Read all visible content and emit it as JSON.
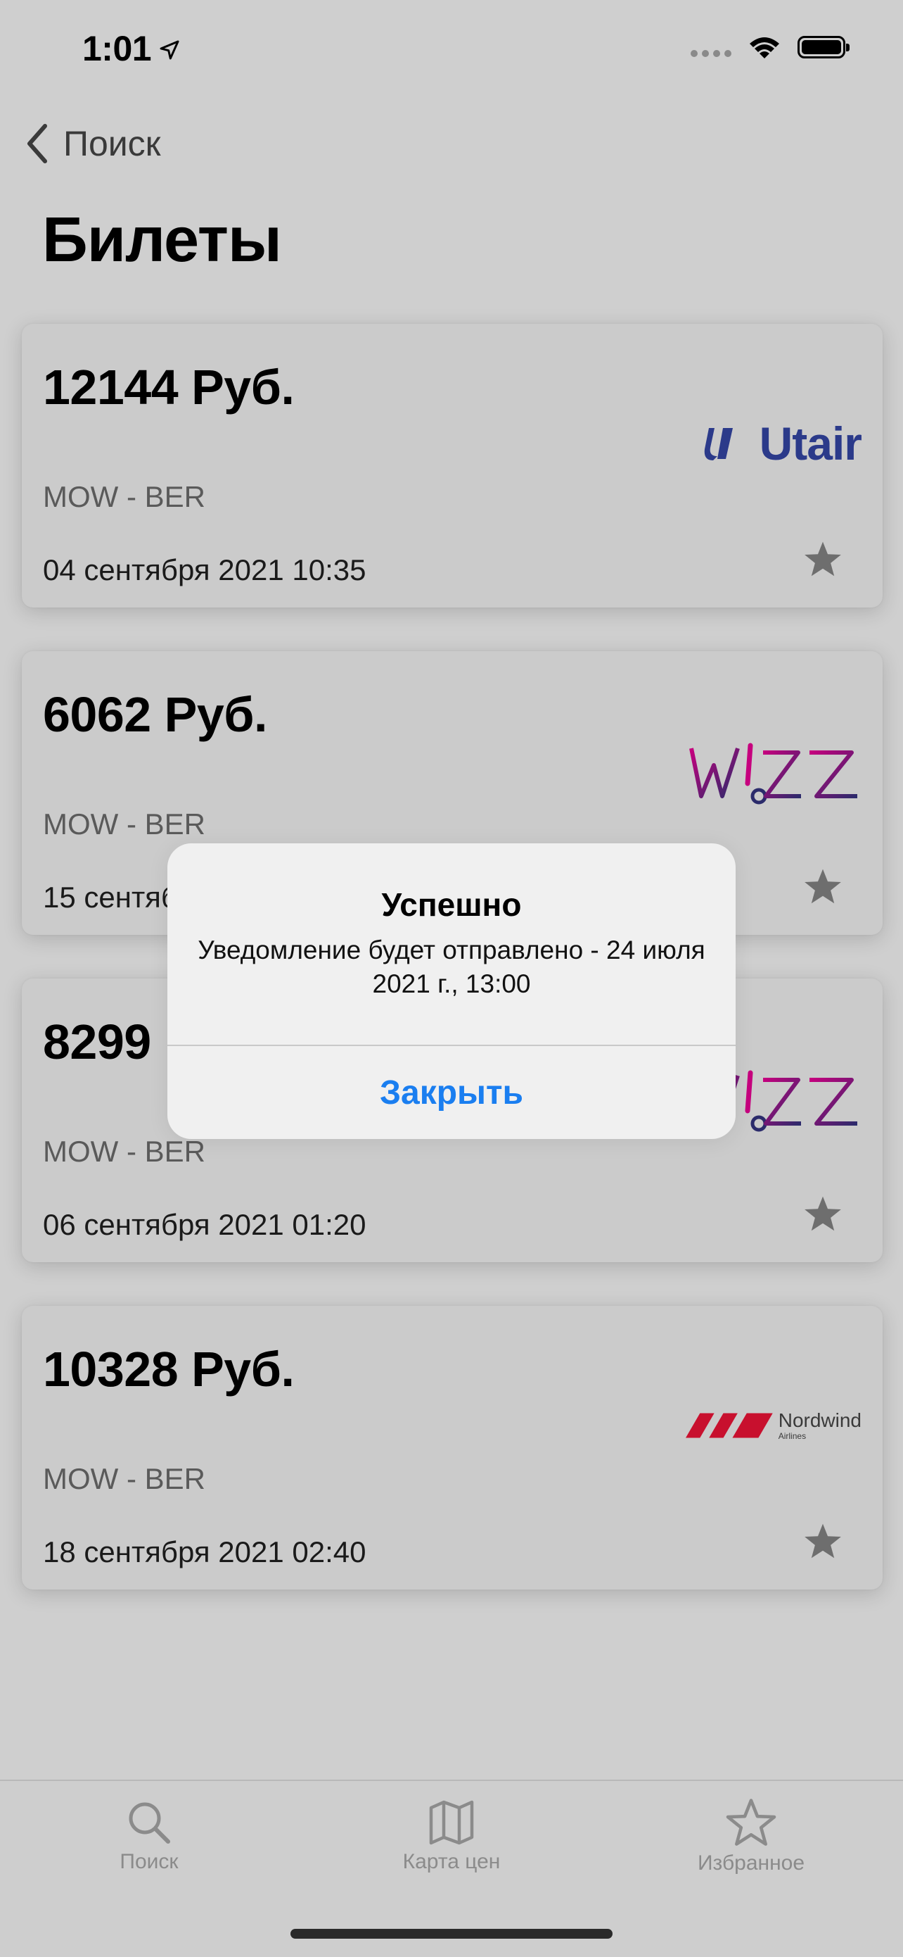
{
  "status_bar": {
    "time": "1:01"
  },
  "nav": {
    "back_label": "Поиск",
    "title": "Билеты"
  },
  "tickets": [
    {
      "price": "12144 Руб.",
      "route": "MOW - BER",
      "date": "04 сентября 2021 10:35",
      "airline": "Utair",
      "favorite": false
    },
    {
      "price": "6062 Руб.",
      "route": "MOW - BER",
      "date": "15 сентября 2021 ",
      "airline": "Wizz",
      "favorite": false
    },
    {
      "price": "8299 Руб.",
      "route": "MOW - BER",
      "date": "06 сентября 2021 01:20",
      "airline": "Wizz",
      "favorite": false
    },
    {
      "price": "10328 Руб.",
      "route": "MOW - BER",
      "date": "18 сентября 2021 02:40",
      "airline": "Nordwind",
      "favorite": false
    }
  ],
  "logos": {
    "utair": "Utair",
    "nordwind": "Nordwind",
    "nordwind_sub": "Airlines"
  },
  "alert": {
    "title": "Успешно",
    "message": "Уведомление будет отправлено - 24 июля 2021 г., 13:00",
    "button": "Закрыть"
  },
  "tab_bar": {
    "items": [
      {
        "label": "Поиск",
        "icon": "search-icon"
      },
      {
        "label": "Карта цен",
        "icon": "map-icon"
      },
      {
        "label": "Избранное",
        "icon": "star-icon"
      }
    ]
  },
  "colors": {
    "accent": "#1a7ef0",
    "utair": "#2b3a8a",
    "wizz_magenta": "#c6007e",
    "wizz_navy": "#2b2b6b",
    "nordwind": "#c8102e"
  }
}
